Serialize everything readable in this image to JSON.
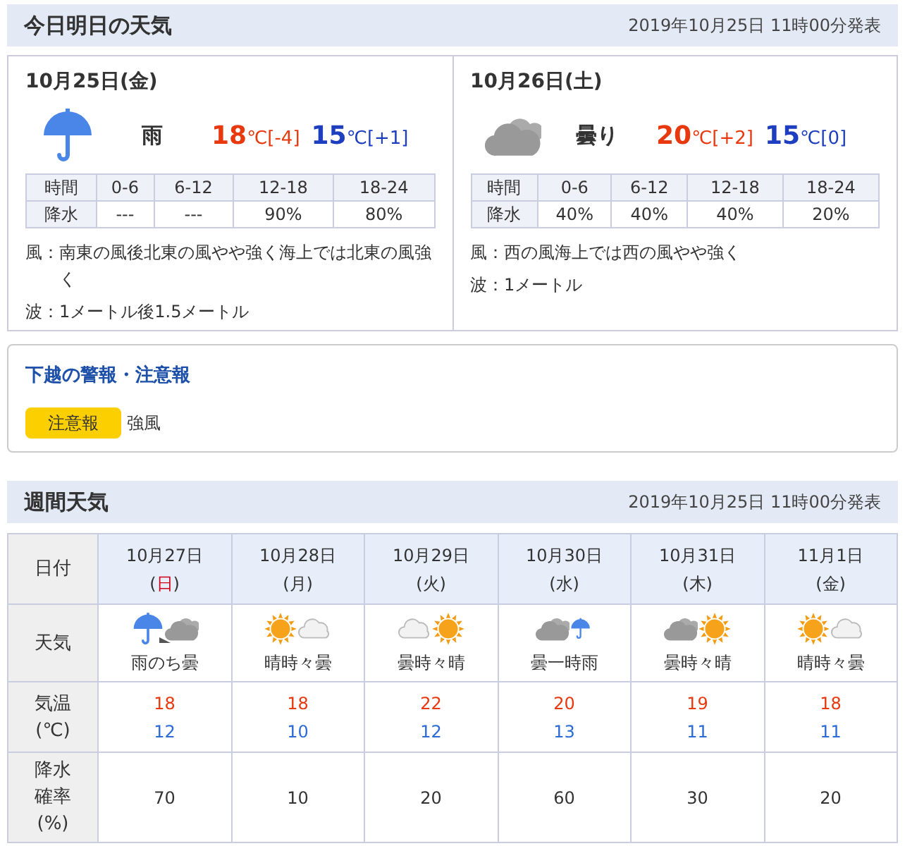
{
  "today_section": {
    "title": "今日明日の天気",
    "issued": "2019年10月25日 11時00分発表"
  },
  "days": [
    {
      "date": "10月25日(金)",
      "icon": {
        "kind": "rain"
      },
      "weather": "雨",
      "high": {
        "value": "18",
        "unit_diff": "℃[-4]"
      },
      "low": {
        "value": "15",
        "unit_diff": "℃[+1]"
      },
      "table": {
        "columns": [
          "時間",
          "0-6",
          "6-12",
          "12-18",
          "18-24"
        ],
        "row": [
          "降水",
          "---",
          "---",
          "90%",
          "80%"
        ]
      },
      "wind_label": "風：",
      "wind": "南東の風後北東の風やや強く海上では北東の風強く",
      "wave_label": "波：",
      "wave": "1メートル後1.5メートル"
    },
    {
      "date": "10月26日(土)",
      "icon": {
        "kind": "cloud"
      },
      "weather": "曇り",
      "high": {
        "value": "20",
        "unit_diff": "℃[+2]"
      },
      "low": {
        "value": "15",
        "unit_diff": "℃[0]"
      },
      "table": {
        "columns": [
          "時間",
          "0-6",
          "6-12",
          "12-18",
          "18-24"
        ],
        "row": [
          "降水",
          "40%",
          "40%",
          "40%",
          "20%"
        ]
      },
      "wind_label": "風：",
      "wind": "西の風海上では西の風やや強く",
      "wave_label": "波：",
      "wave": "1メートル"
    }
  ],
  "warnings": {
    "title": "下越の警報・注意報",
    "items": [
      {
        "badge": "注意報",
        "text": "強風"
      }
    ]
  },
  "weekly_section": {
    "title": "週間天気",
    "issued": "2019年10月25日 11時00分発表"
  },
  "weekly": {
    "row_labels": [
      [
        "日付"
      ],
      [
        "天気"
      ],
      [
        "気温",
        "(℃)"
      ],
      [
        "降水",
        "確率",
        "(%)"
      ]
    ],
    "days": [
      {
        "date": "10月27日",
        "dow_open": "(",
        "dow": "日",
        "dow_close": ")",
        "sunday": true,
        "icons": [
          {
            "kind": "rain"
          },
          {
            "kind": "arrow"
          },
          {
            "kind": "cloud"
          }
        ],
        "weather": "雨のち曇",
        "high": "18",
        "low": "12",
        "pop": "70"
      },
      {
        "date": "10月28日",
        "dow_open": "(",
        "dow": "月",
        "dow_close": ")",
        "sunday": false,
        "icons": [
          {
            "kind": "sun"
          },
          {
            "kind": "light-cloud"
          }
        ],
        "weather": "晴時々曇",
        "high": "18",
        "low": "10",
        "pop": "10"
      },
      {
        "date": "10月29日",
        "dow_open": "(",
        "dow": "火",
        "dow_close": ")",
        "sunday": false,
        "icons": [
          {
            "kind": "light-cloud"
          },
          {
            "kind": "sun"
          }
        ],
        "weather": "曇時々晴",
        "high": "22",
        "low": "12",
        "pop": "20"
      },
      {
        "date": "10月30日",
        "dow_open": "(",
        "dow": "水",
        "dow_close": ")",
        "sunday": false,
        "icons": [
          {
            "kind": "cloud"
          },
          {
            "kind": "small-rain"
          }
        ],
        "weather": "曇一時雨",
        "high": "20",
        "low": "13",
        "pop": "60"
      },
      {
        "date": "10月31日",
        "dow_open": "(",
        "dow": "木",
        "dow_close": ")",
        "sunday": false,
        "icons": [
          {
            "kind": "cloud"
          },
          {
            "kind": "sun"
          }
        ],
        "weather": "曇時々晴",
        "high": "19",
        "low": "11",
        "pop": "30"
      },
      {
        "date": "11月1日",
        "dow_open": "(",
        "dow": "金",
        "dow_close": ")",
        "sunday": false,
        "icons": [
          {
            "kind": "sun"
          },
          {
            "kind": "light-cloud"
          }
        ],
        "weather": "晴時々曇",
        "high": "18",
        "low": "11",
        "pop": "20"
      }
    ]
  }
}
